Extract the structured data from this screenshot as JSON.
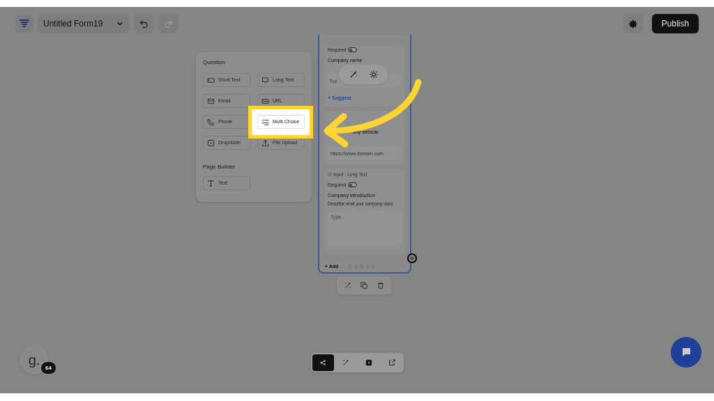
{
  "header": {
    "form_name": "Untitled Form19",
    "undo_disabled": false,
    "redo_disabled": true,
    "publish": "Publish"
  },
  "question_panel": {
    "sections": [
      {
        "heading": "Question",
        "items": [
          {
            "label": "Short Text",
            "highlighted": false
          },
          {
            "label": "Long Text",
            "highlighted": false
          },
          {
            "label": "Email",
            "highlighted": false
          },
          {
            "label": "URL",
            "highlighted": false
          },
          {
            "label": "Phone",
            "highlighted": false
          },
          {
            "label": "Multi Choice",
            "highlighted": true
          },
          {
            "label": "Dropdown",
            "highlighted": false
          },
          {
            "label": "File Upload",
            "highlighted": false
          }
        ]
      },
      {
        "heading": "Page Builder",
        "items": [
          {
            "label": "Text",
            "highlighted": false
          }
        ]
      }
    ]
  },
  "form_card": {
    "blocks": [
      {
        "required_label": "Required",
        "required": false,
        "title": "Company name",
        "placeholder": "Typ",
        "suggest": "+ Suggest"
      },
      {
        "title": "any website",
        "placeholder": "https://www.domain.com"
      },
      {
        "type_label": "Input · Long Text",
        "required_label": "Required",
        "required": false,
        "title": "Company introduction",
        "description": "Describe what your company does",
        "placeholder": "Type..."
      }
    ],
    "add": "+ Add"
  },
  "user": {
    "initial": "g.",
    "count": "64"
  },
  "bottom_toolbar": [
    {
      "selected": true
    },
    {
      "selected": false
    },
    {
      "selected": false
    },
    {
      "selected": false
    }
  ]
}
